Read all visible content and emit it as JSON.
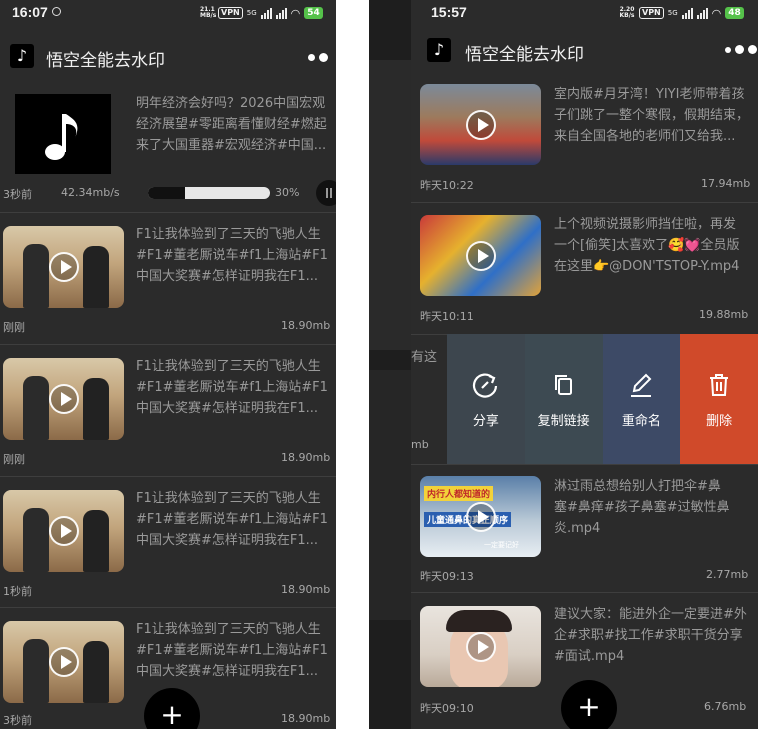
{
  "colors": {
    "phone_bg": "#2b2b2b",
    "delete": "#d04a2a",
    "rename": "#3d4a66",
    "copy": "#3d4a52",
    "share": "#3d464e",
    "battery": "#55c24a"
  },
  "left": {
    "status": {
      "time": "16:07",
      "speed": "21.1 MB/s",
      "vpn": "VPN",
      "network": "5G",
      "battery": "54"
    },
    "app_title": "悟空全能去水印",
    "downloading": {
      "title_lines": [
        "明年经济会好吗？2026中国宏观",
        "经济展望#零距离看懂财经#燃起",
        "来了大国重器#宏观经济#中国..."
      ],
      "time": "3秒前",
      "speed": "42.34mb/s",
      "percent_label": "30%",
      "progress": 0.3
    },
    "items": [
      {
        "title_lines": [
          "F1让我体验到了三天的飞驰人生",
          "#F1#董老厮说车#f1上海站#F1",
          "中国大奖赛#怎样证明我在F1..."
        ],
        "time": "刚刚",
        "size": "18.90mb"
      },
      {
        "title_lines": [
          "F1让我体验到了三天的飞驰人生",
          "#F1#董老厮说车#f1上海站#F1",
          "中国大奖赛#怎样证明我在F1..."
        ],
        "time": "刚刚",
        "size": "18.90mb"
      },
      {
        "title_lines": [
          "F1让我体验到了三天的飞驰人生",
          "#F1#董老厮说车#f1上海站#F1",
          "中国大奖赛#怎样证明我在F1..."
        ],
        "time": "1秒前",
        "size": "18.90mb"
      },
      {
        "title_lines": [
          "F1让我体验到了三天的飞驰人生",
          "#F1#董老厮说车#f1上海站#F1",
          "中国大奖赛#怎样证明我在F1..."
        ],
        "time": "3秒前",
        "size": "18.90mb"
      }
    ],
    "fab_label": "+"
  },
  "right": {
    "status": {
      "time": "15:57",
      "speed": "2.20 KB/s",
      "vpn": "VPN",
      "network": "5G",
      "battery": "48"
    },
    "app_title": "悟空全能去水印",
    "items": [
      {
        "title_lines": [
          "室内版#月牙湾！YIYI老师带着孩",
          "子们跳了一整个寒假，假期结束，",
          "来自全国各地的老师们又给我..."
        ],
        "time": "昨天10:22",
        "size": "17.94mb"
      },
      {
        "title_lines": [
          "上个视频说摄影师挡住啦，再发",
          "一个[偷笑]太喜欢了🥰💓全员版",
          "在这里👉@DON'TSTOP-Y.mp4"
        ],
        "time": "昨天10:11",
        "size": "19.88mb"
      },
      {
        "title_lines": [
          "淋过雨总想给别人打把伞#鼻",
          "塞#鼻痒#孩子鼻塞#过敏性鼻",
          "炎.mp4"
        ],
        "time": "昨天09:13",
        "size": "2.77mb"
      },
      {
        "title_lines": [
          "建议大家：能进外企一定要进#外",
          "企#求职#找工作#求职干货分享",
          "#面试.mp4"
        ],
        "time": "昨天09:10",
        "size": "6.76mb"
      }
    ],
    "swiped_peek": {
      "text": "有这",
      "size_tail": "mb"
    },
    "thumb_caption": {
      "top": "内行人都知道的",
      "mid": "儿童通鼻的真正顺序",
      "bot": "一定要记好"
    },
    "actions": [
      {
        "label": "分享",
        "icon": "share-icon"
      },
      {
        "label": "复制链接",
        "icon": "copy-icon"
      },
      {
        "label": "重命名",
        "icon": "edit-icon"
      },
      {
        "label": "删除",
        "icon": "trash-icon"
      }
    ],
    "fab_label": "+"
  }
}
